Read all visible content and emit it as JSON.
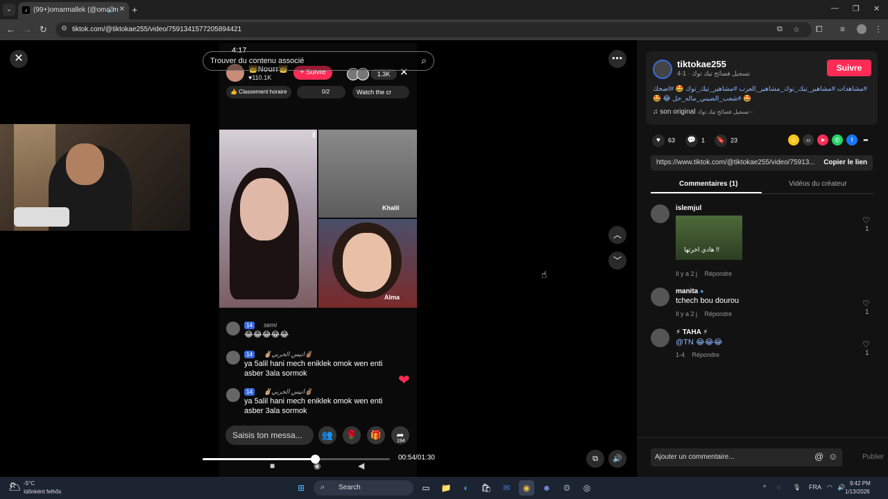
{
  "browser": {
    "tab_title": "(99+)omarmallek (@omarm",
    "url": "tiktok.com/@tiktokae255/video/7591341577205894421"
  },
  "video": {
    "phone_time": "4:17",
    "search_placeholder": "Trouver du contenu associé",
    "host_name": "👑Nourr👑",
    "host_likes": "♥110.1K",
    "follow_pill": "+ Suivre",
    "viewer_count": "1.3K",
    "chip_ranking": "👍 Classement horaire",
    "chip_counter": "0/2",
    "chip_watch": "Watch the cr",
    "guest1": "Khalil",
    "guest2": "Alma",
    "comments": [
      {
        "badge": "14",
        "user": "semi",
        "text": "😂😂😂😂😂"
      },
      {
        "badge": "14",
        "user": "✌🏼انيس الحربي✌🏽",
        "text": "ya 5alil hani mech eniklek omok wen enti asber 3ala sormok"
      },
      {
        "badge": "14",
        "user": "✌🏼انيس الحربي✌🏽",
        "text": "ya 5alil hani mech eniklek omok wen enti asber 3ala sormok"
      }
    ],
    "input_placeholder": "Saisis ton messa...",
    "share_count": "194",
    "time_readout": "00:54/01:30",
    "progress": 0.6
  },
  "panel": {
    "author": "tiktokae255",
    "author_sub": "تسجيل فضائح تيك توك · 1-4",
    "follow": "Suivre",
    "hashtags": "#مشاهدات #مشاهير_تيك_توك_مشاهير_العرب #مشاهير_تيك_توك 🤩 #اضحك 🤩 #شعب_الصيني_ماله_حل 😂 🤩",
    "music_label": "son original",
    "music_source": "تسجيل فضائح تيك توك -",
    "likes": "63",
    "comments_count": "1",
    "saves": "23",
    "link": "https://www.tiktok.com/@tiktokae255/video/75913...",
    "copy_link": "Copier le lien",
    "tab_comments": "Commentaires (1)",
    "tab_creator": "Vidéos du créateur",
    "comments": [
      {
        "name": "islemjul",
        "text": "",
        "gif_caption": "!! هادي اخرتها",
        "meta": "Il y a 2 j",
        "reply": "Répondre",
        "likes": "1"
      },
      {
        "name": "manita",
        "text": "tchech bou dourou",
        "meta": "Il y a 2 j",
        "reply": "Répondre",
        "likes": "1"
      },
      {
        "name": "⚡ TAHA ⚡",
        "text": "@TN 😂😂😂",
        "meta": "1-4",
        "reply": "Répondre",
        "likes": "1"
      }
    ],
    "add_comment": "Ajouter un commentaire...",
    "publish": "Publier"
  },
  "taskbar": {
    "temp": "-5°C",
    "weather_desc": "Időnként felhős",
    "search": "Search",
    "lang": "FRA",
    "time": "9:42 PM",
    "date": "1/13/2026"
  },
  "colors": {
    "accent": "#fe2c55",
    "link": "#8fb8ff"
  }
}
